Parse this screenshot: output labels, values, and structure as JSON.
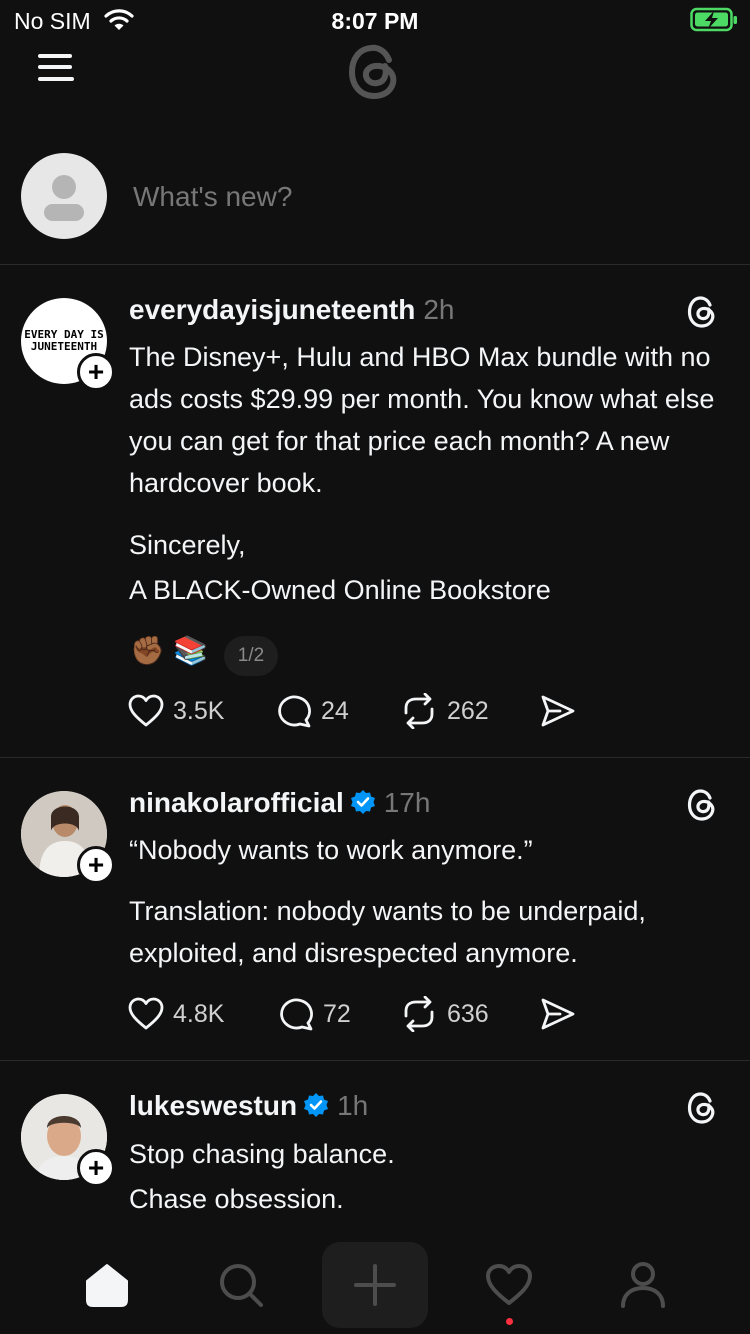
{
  "status_bar": {
    "carrier": "No SIM",
    "time": "8:07 PM",
    "icons": [
      "wifi-icon",
      "battery-charging-icon"
    ],
    "battery_color": "#4cd964"
  },
  "header": {
    "icons": [
      "menu-icon",
      "threads-logo-icon"
    ]
  },
  "composer": {
    "placeholder": "What's new?",
    "avatar_icon": "default-avatar-icon"
  },
  "posts": [
    {
      "username": "everydayisjuneteenth",
      "verified": false,
      "time": "2h",
      "avatar_text": [
        "EVERY DAY IS",
        "JUNETEENTH"
      ],
      "paragraphs": [
        "The Disney+, Hulu and HBO Max bundle with no ads costs $29.99 per month. You know what else you can get for that price each month? A new hardcover book.",
        "Sincerely,\nA BLACK-Owned Online Bookstore"
      ],
      "emojis": [
        "✊🏾",
        "📚"
      ],
      "pager": "1/2",
      "likes": "3.5K",
      "replies": "24",
      "reposts": "262"
    },
    {
      "username": "ninakolarofficial",
      "verified": true,
      "time": "17h",
      "paragraphs": [
        "“Nobody wants to work anymore.”",
        "Translation: nobody wants to be underpaid, exploited, and disrespected anymore."
      ],
      "likes": "4.8K",
      "replies": "72",
      "reposts": "636"
    },
    {
      "username": "lukeswestun",
      "verified": true,
      "time": "1h",
      "paragraphs": [
        "Stop chasing balance.\nChase obsession."
      ]
    }
  ],
  "tab_bar": {
    "items": [
      "home-icon",
      "search-icon",
      "create-icon",
      "activity-icon",
      "profile-icon"
    ],
    "notification_dot_color": "#ff3040"
  },
  "colors": {
    "background": "#101010",
    "text": "#f3f5f7",
    "muted": "#777777",
    "verified": "#0095f6"
  }
}
